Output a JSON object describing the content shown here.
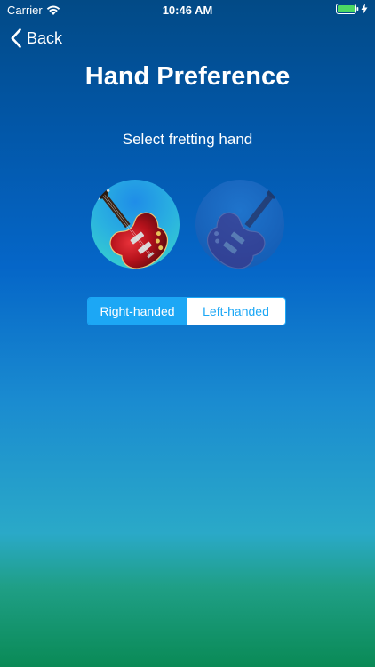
{
  "status_bar": {
    "carrier": "Carrier",
    "time": "10:46 AM",
    "wifi_icon": "wifi-icon",
    "battery_icon": "battery-icon",
    "charging_icon": "bolt-icon"
  },
  "nav": {
    "back_label": "Back",
    "back_icon": "chevron-left-icon"
  },
  "screen": {
    "title": "Hand Preference",
    "subtitle": "Select fretting hand"
  },
  "options": [
    {
      "name": "right-handed-guitar",
      "selected": true
    },
    {
      "name": "left-handed-guitar",
      "selected": false
    }
  ],
  "segmented_control": {
    "items": [
      {
        "label": "Right-handed",
        "selected": true
      },
      {
        "label": "Left-handed",
        "selected": false
      }
    ]
  },
  "colors": {
    "accent": "#1ca7f5",
    "guitar_body": "#b5121b"
  }
}
